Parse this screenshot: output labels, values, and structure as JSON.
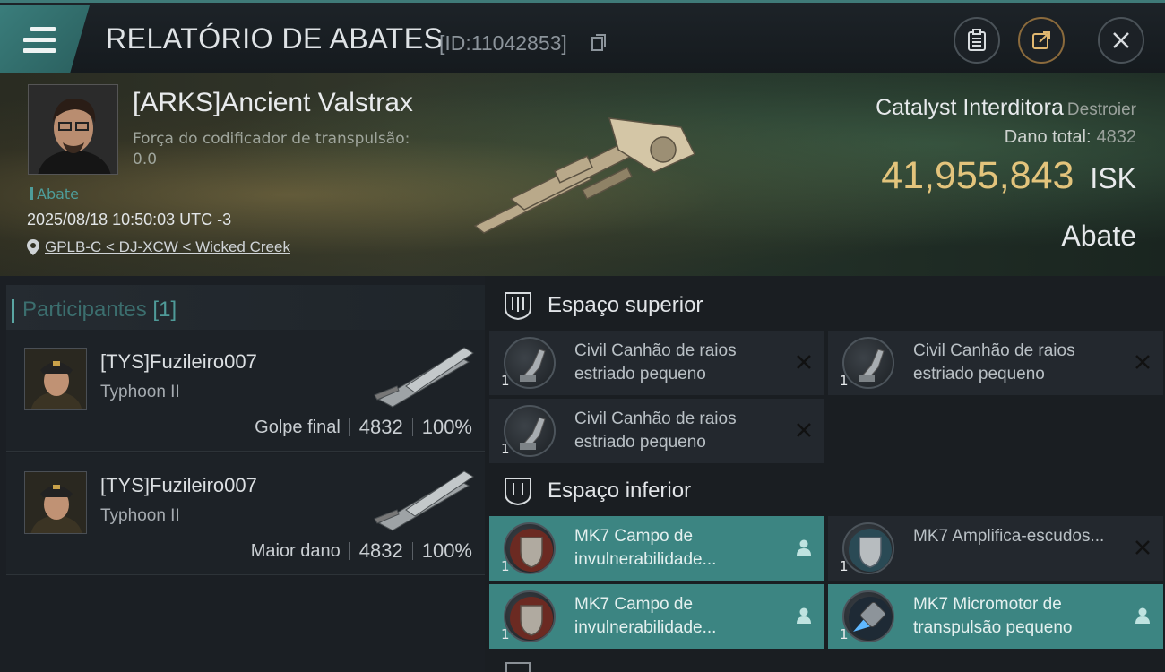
{
  "header": {
    "title": "RELATÓRIO DE ABATES",
    "report_id": "[ID:11042853]"
  },
  "victim": {
    "name": "[ARKS]Ancient Valstrax",
    "warp_label": "Força do codificador de transpulsão:",
    "warp_value": "0.0",
    "kill_tag": "Abate",
    "date": "2025/08/18 10:50:03 UTC -3",
    "location": "GPLB-C < DJ-XCW < Wicked Creek",
    "ship_name": "Catalyst Interditora",
    "ship_class": "Destroier",
    "damage_label": "Dano total:",
    "damage_value": "4832",
    "isk_value": "41,955,843",
    "isk_unit": "ISK",
    "kill_type": "Abate"
  },
  "participants": {
    "label": "Participantes",
    "count": "[1]",
    "items": [
      {
        "name": "[TYS]Fuzileiro007",
        "ship": "Typhoon II",
        "role": "Golpe final",
        "damage": "4832",
        "percent": "100%"
      },
      {
        "name": "[TYS]Fuzileiro007",
        "ship": "Typhoon II",
        "role": "Maior dano",
        "damage": "4832",
        "percent": "100%"
      }
    ]
  },
  "slots": {
    "high": {
      "label": "Espaço superior",
      "modules": [
        {
          "qty": "1",
          "name": "Civil Canhão de raios estriado pequeno",
          "icon": "laser-turret-icon",
          "action": "destroyed-icon"
        },
        {
          "qty": "1",
          "name": "Civil Canhão de raios estriado pequeno",
          "icon": "laser-turret-icon",
          "action": "destroyed-icon"
        },
        {
          "qty": "1",
          "name": "Civil Canhão de raios estriado pequeno",
          "icon": "laser-turret-icon",
          "action": "destroyed-icon"
        }
      ]
    },
    "low": {
      "label": "Espaço inferior",
      "modules": [
        {
          "qty": "1",
          "name": "MK7 Campo de invulnerabilidade...",
          "icon": "shield-icon",
          "action": "dropped-icon"
        },
        {
          "qty": "1",
          "name": "MK7 Amplifica-escudos...",
          "icon": "shield-icon",
          "action": "destroyed-icon"
        },
        {
          "qty": "1",
          "name": "MK7 Campo de invulnerabilidade...",
          "icon": "shield-icon",
          "action": "dropped-icon"
        },
        {
          "qty": "1",
          "name": "MK7 Micromotor de transpulsão pequeno",
          "icon": "thruster-icon",
          "action": "dropped-icon"
        }
      ]
    }
  },
  "colors": {
    "accent_teal": "#3c8582",
    "isk_gold": "#e3c47c",
    "dropped_highlight": "#3c8582"
  }
}
